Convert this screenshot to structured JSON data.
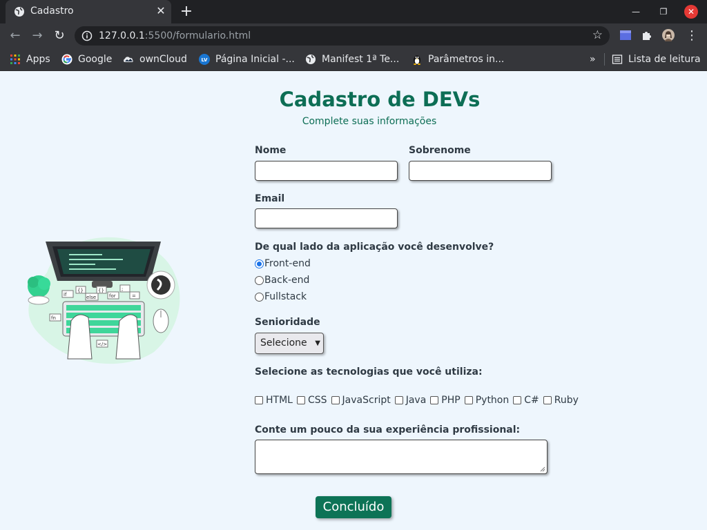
{
  "browser": {
    "tab_title": "Cadastro",
    "url_host": "127.0.0.1",
    "url_path": ":5500/formulario.html",
    "bookmarks": [
      {
        "label": "Apps",
        "icon": "apps-grid-icon"
      },
      {
        "label": "Google",
        "icon": "google-icon"
      },
      {
        "label": "ownCloud",
        "icon": "owncloud-icon"
      },
      {
        "label": "Página Inicial -...",
        "icon": "lv-icon"
      },
      {
        "label": "Manifest 1ª Te...",
        "icon": "globe-icon"
      },
      {
        "label": "Parâmetros in...",
        "icon": "tux-icon"
      }
    ],
    "more_bookmarks": "»",
    "reading_list": "Lista de leitura"
  },
  "form": {
    "title": "Cadastro de DEVs",
    "subtitle": "Complete suas informações",
    "nome_label": "Nome",
    "sobrenome_label": "Sobrenome",
    "email_label": "Email",
    "lado_question": "De qual lado da aplicação você desenvolve?",
    "lado_options": [
      "Front-end",
      "Back-end",
      "Fullstack"
    ],
    "lado_selected": "Front-end",
    "senioridade_label": "Senioridade",
    "senioridade_value": "Selecione",
    "tech_question": "Selecione as tecnologias que você utiliza:",
    "techs": [
      "HTML",
      "CSS",
      "JavaScript",
      "Java",
      "PHP",
      "Python",
      "C#",
      "Ruby"
    ],
    "experiencia_label": "Conte um pouco da sua experiência profissional:",
    "submit_label": "Concluído"
  },
  "colors": {
    "accent": "#0d7356",
    "title": "#0d6e55",
    "page_bg": "#eef6fd"
  }
}
